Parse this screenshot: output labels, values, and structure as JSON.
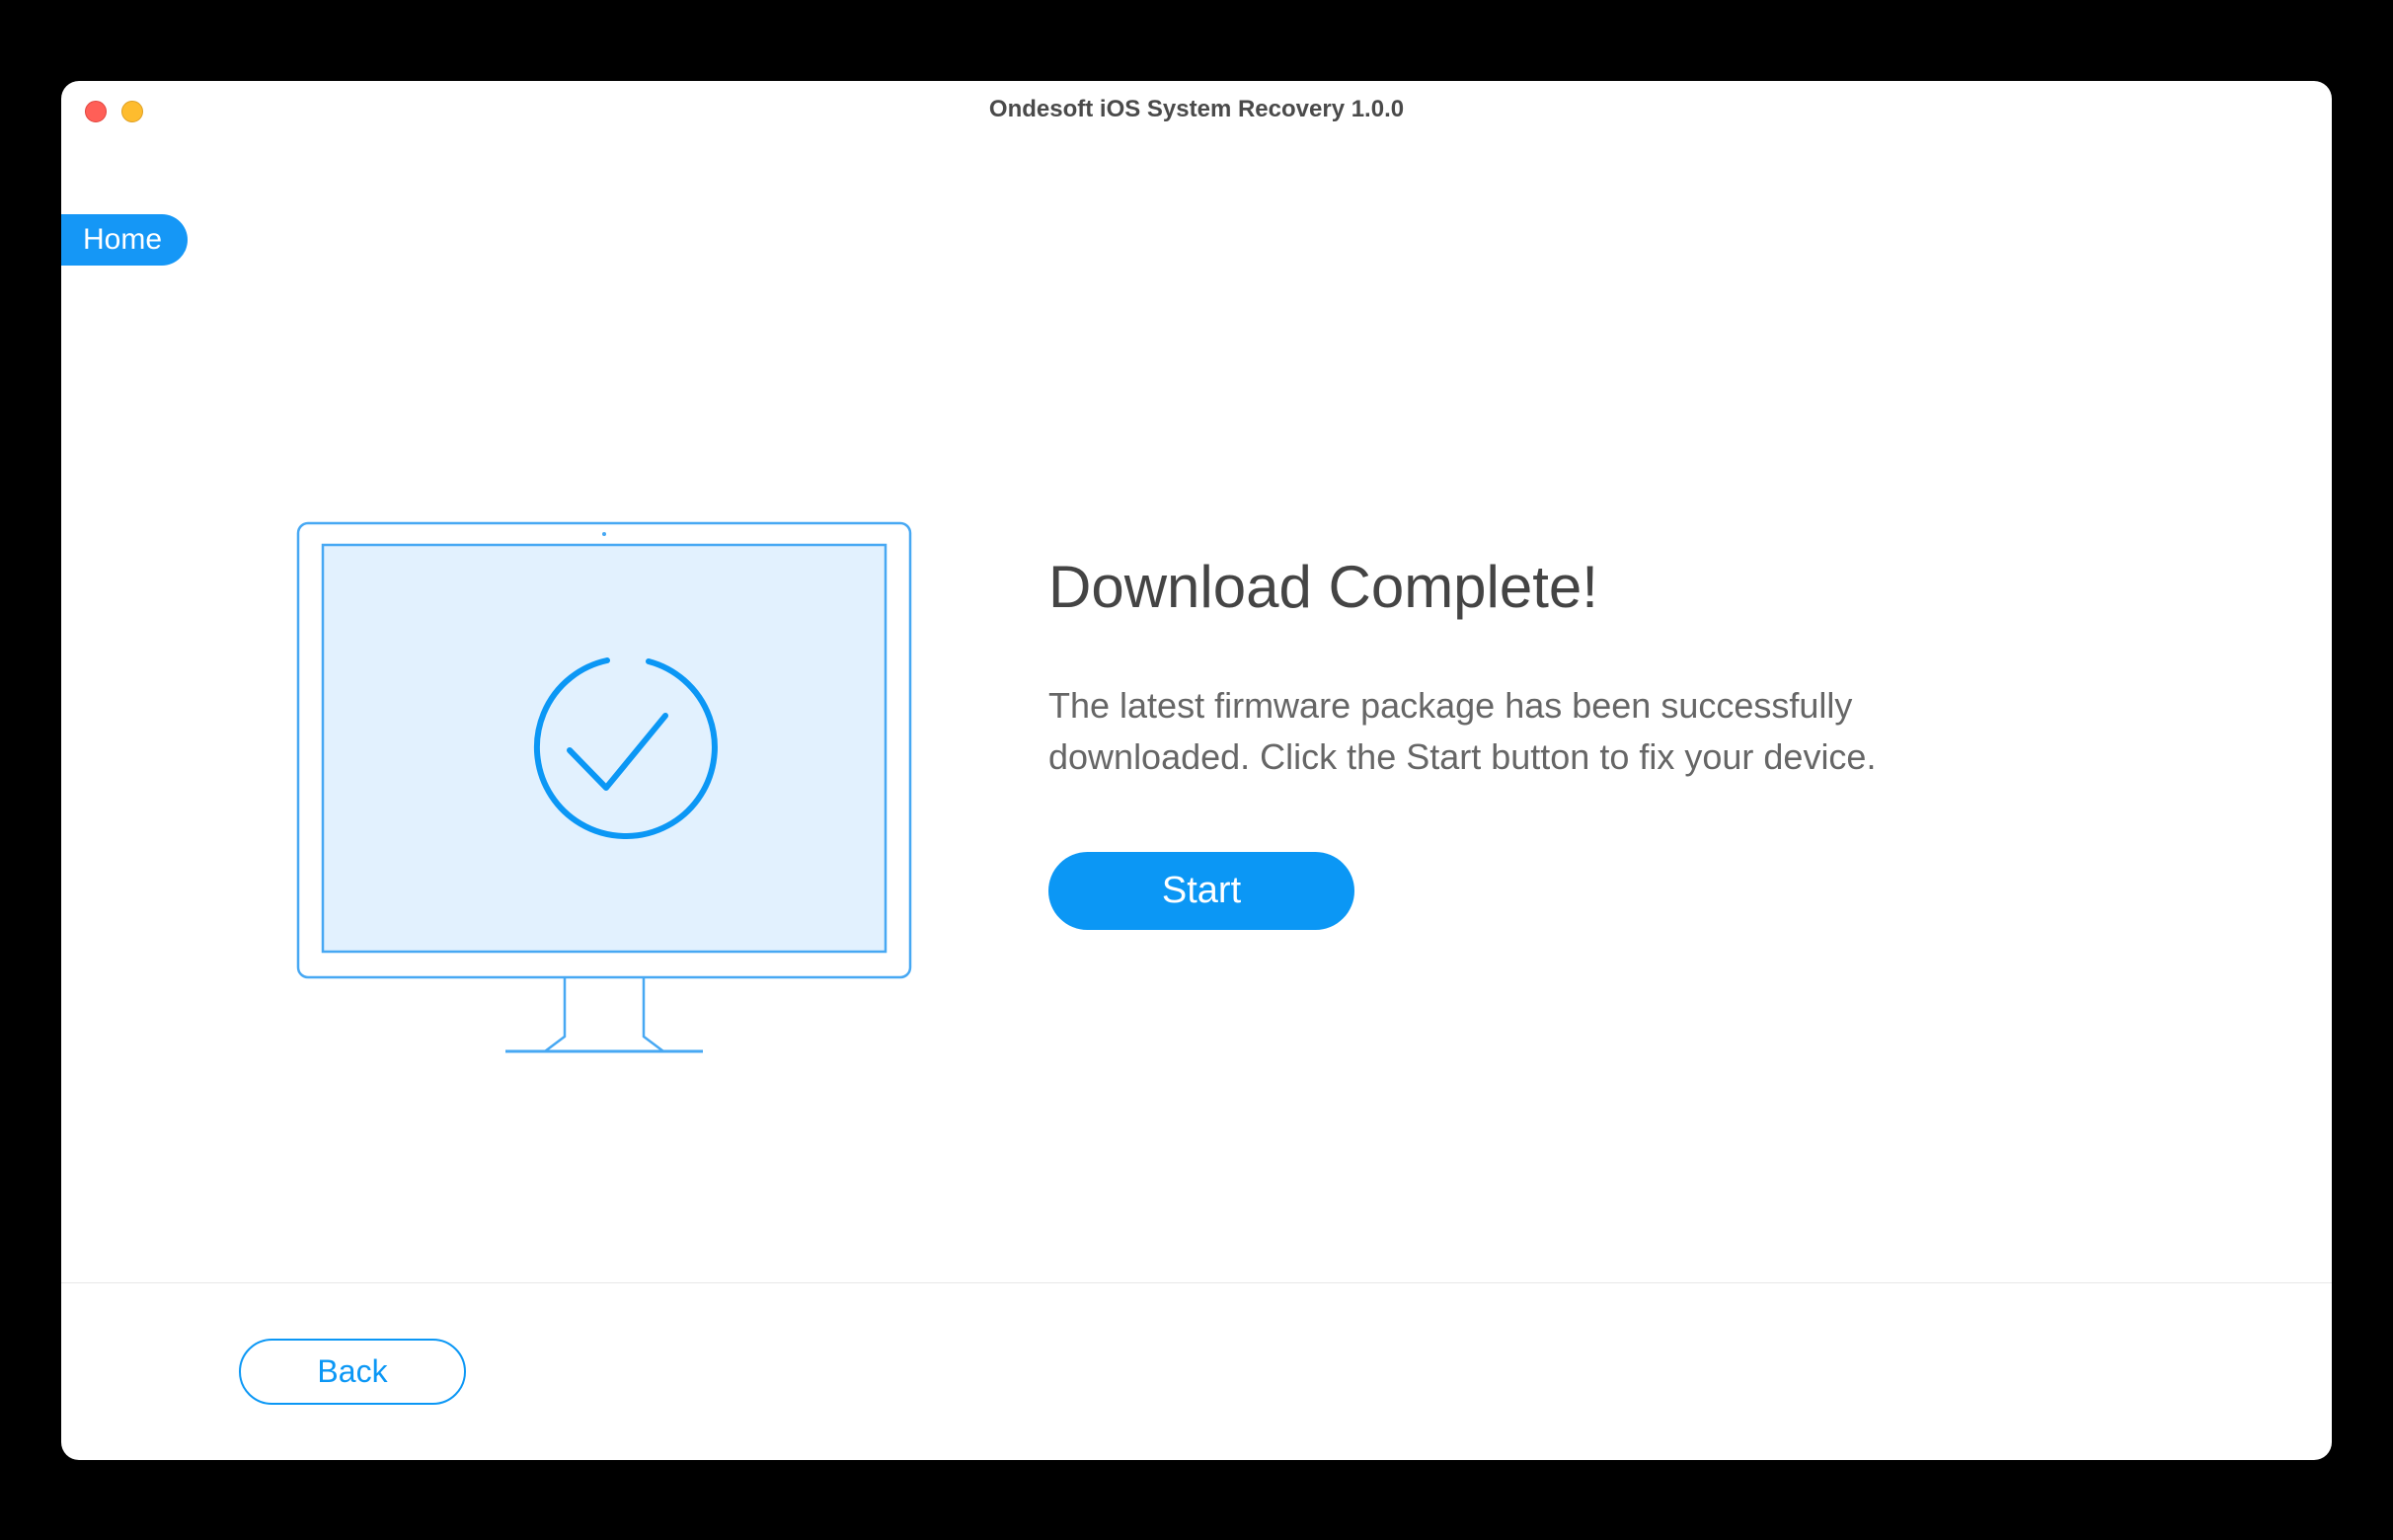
{
  "window": {
    "title": "Ondesoft iOS System Recovery 1.0.0"
  },
  "breadcrumb": {
    "home_label": "Home"
  },
  "main": {
    "heading": "Download Complete!",
    "description": "The latest firmware package has been successfully downloaded. Click the Start button to fix your device.",
    "start_label": "Start"
  },
  "footer": {
    "back_label": "Back"
  },
  "colors": {
    "accent": "#0b97f5",
    "illustration_stroke": "#47a8f3",
    "illustration_fill": "#e2f1fe"
  }
}
